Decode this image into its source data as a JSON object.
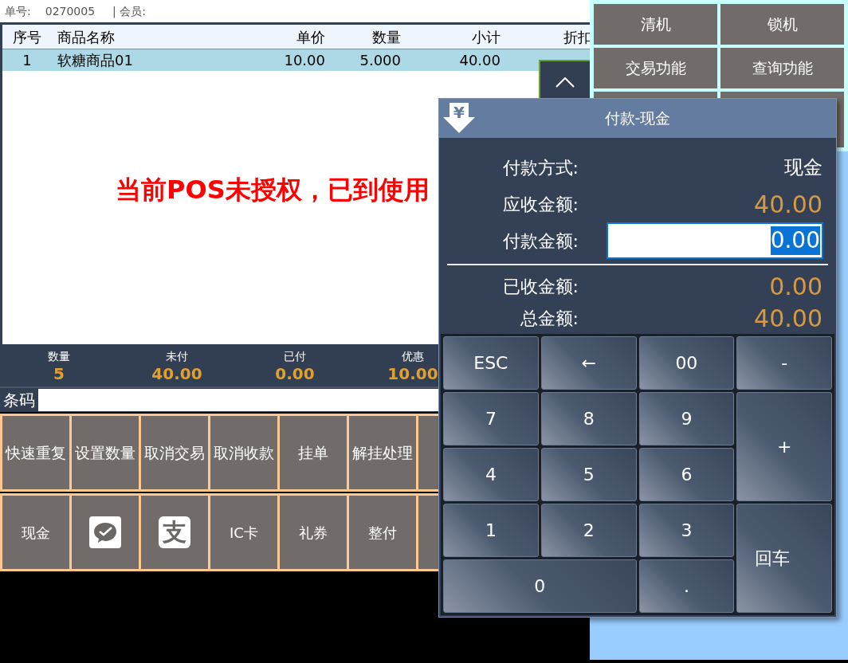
{
  "header": {
    "order_label": "单号:",
    "order_no": "0270005",
    "member_label": "| 会员:"
  },
  "table": {
    "columns": [
      "序号",
      "商品名称",
      "单价",
      "数量",
      "小计",
      "折扣"
    ],
    "rows": [
      {
        "cells": [
          "1",
          "软糖商品01",
          "10.00",
          "5.000",
          "40.00"
        ],
        "selected": true
      }
    ]
  },
  "warning": "当前POS未授权，已到使用",
  "summary": [
    {
      "label": "数量",
      "value": "5"
    },
    {
      "label": "未付",
      "value": "40.00"
    },
    {
      "label": "已付",
      "value": "0.00"
    },
    {
      "label": "优惠",
      "value": "10.00"
    }
  ],
  "barcode": {
    "label": "条码"
  },
  "function_buttons": [
    "快速重复",
    "设置数量",
    "取消交易",
    "取消收款",
    "挂单",
    "解挂处理"
  ],
  "payment_buttons": [
    {
      "kind": "text",
      "label": "现金"
    },
    {
      "kind": "wechat"
    },
    {
      "kind": "logo",
      "label": "支"
    },
    {
      "kind": "text",
      "label": "IC卡"
    },
    {
      "kind": "text",
      "label": "礼券"
    },
    {
      "kind": "text",
      "label": "整付"
    }
  ],
  "side_buttons": [
    "清机",
    "锁机",
    "交易功能",
    "查询功能"
  ],
  "dialog": {
    "title": "付款-现金",
    "icon_glyph": "¥",
    "rows": [
      {
        "label": "付款方式:",
        "value": "现金",
        "kind": "plain"
      },
      {
        "label": "应收金额:",
        "value": "40.00",
        "kind": "amount"
      },
      {
        "label": "付款金额:",
        "value": "0.00",
        "kind": "input",
        "text_selected": true
      }
    ],
    "totals": [
      {
        "label": "已收金额:",
        "value": "0.00"
      },
      {
        "label": "总金额:",
        "value": "40.00"
      }
    ],
    "keys": [
      {
        "label": "ESC",
        "kind": "normal"
      },
      {
        "label": "←",
        "kind": "normal"
      },
      {
        "label": "00",
        "kind": "normal"
      },
      {
        "label": "-",
        "kind": "normal"
      },
      {
        "label": "7",
        "kind": "normal"
      },
      {
        "label": "8",
        "kind": "normal"
      },
      {
        "label": "9",
        "kind": "normal"
      },
      {
        "label": "+",
        "kind": "tall"
      },
      {
        "label": "4",
        "kind": "normal"
      },
      {
        "label": "5",
        "kind": "normal"
      },
      {
        "label": "6",
        "kind": "normal"
      },
      {
        "label": "1",
        "kind": "normal"
      },
      {
        "label": "2",
        "kind": "normal"
      },
      {
        "label": "3",
        "kind": "normal"
      },
      {
        "label": "回车",
        "kind": "tall"
      },
      {
        "label": "0",
        "kind": "wide"
      },
      {
        "label": ".",
        "kind": "normal"
      }
    ]
  }
}
